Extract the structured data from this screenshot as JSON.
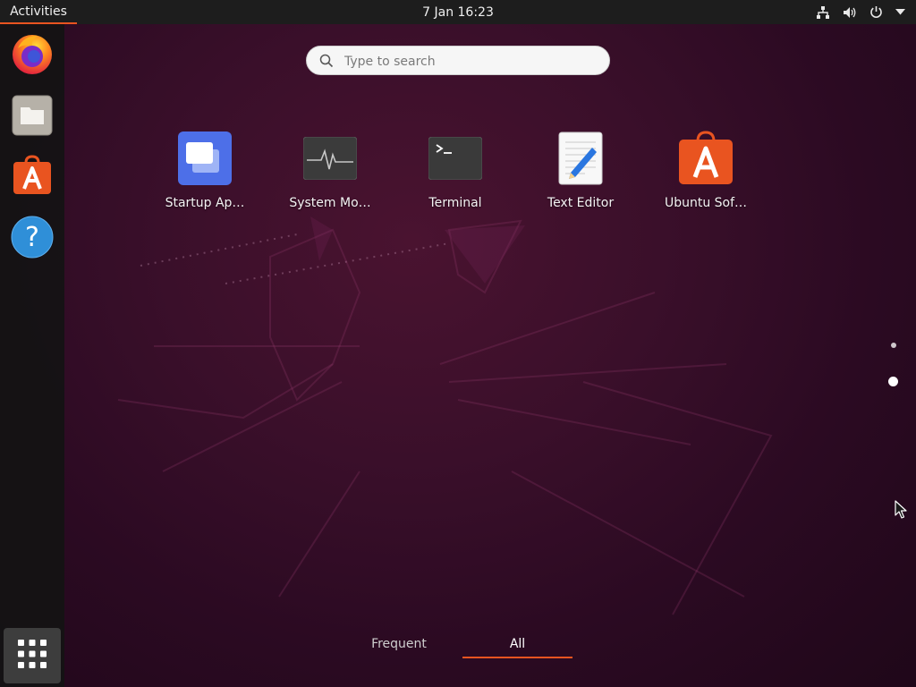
{
  "topbar": {
    "activities_label": "Activities",
    "clock": "7 Jan  16:23",
    "indicators": [
      "network-icon",
      "volume-icon",
      "power-icon",
      "menu-arrow-icon"
    ]
  },
  "dock": {
    "items": [
      {
        "name": "firefox",
        "icon": "firefox-icon"
      },
      {
        "name": "files",
        "icon": "files-icon"
      },
      {
        "name": "ubuntu-software",
        "icon": "software-store-icon"
      },
      {
        "name": "help",
        "icon": "help-icon"
      }
    ],
    "show_apps_icon": "apps-grid-icon"
  },
  "search": {
    "placeholder": "Type to search"
  },
  "apps": [
    {
      "label": "Startup Ap…",
      "icon": "startup-apps-icon"
    },
    {
      "label": "System Mo…",
      "icon": "system-monitor-icon"
    },
    {
      "label": "Terminal",
      "icon": "terminal-icon"
    },
    {
      "label": "Text Editor",
      "icon": "text-editor-icon"
    },
    {
      "label": "Ubuntu Sof…",
      "icon": "ubuntu-software-icon"
    }
  ],
  "pages": {
    "count": 2,
    "current": 2
  },
  "view_switcher": {
    "frequent_label": "Frequent",
    "all_label": "All",
    "active": "All"
  },
  "colors": {
    "accent": "#e95420",
    "topbar": "#1d1d1d",
    "background": "#2c0a23"
  }
}
